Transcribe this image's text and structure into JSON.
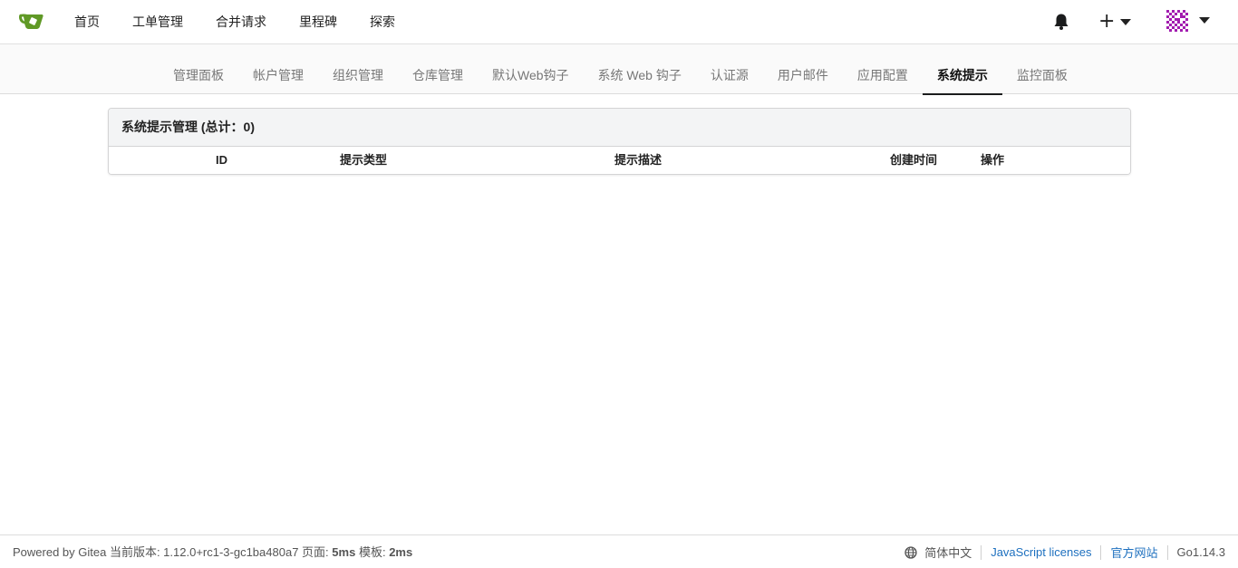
{
  "navbar": {
    "links": [
      "首页",
      "工单管理",
      "合并请求",
      "里程碑",
      "探索"
    ],
    "icons": [
      "gitea-logo-icon",
      "bell-icon",
      "plus-icon",
      "caret-down-icon",
      "avatar"
    ],
    "brand_color": "#609926"
  },
  "admin_menu": {
    "items": [
      "管理面板",
      "帐户管理",
      "组织管理",
      "仓库管理",
      "默认Web钩子",
      "系统 Web 钩子",
      "认证源",
      "用户邮件",
      "应用配置",
      "系统提示",
      "监控面板"
    ],
    "active_index": 9
  },
  "notices": {
    "header": "系统提示管理 (总计：0)",
    "columns": [
      "ID",
      "提示类型",
      "提示描述",
      "创建时间",
      "操作"
    ],
    "rows": []
  },
  "footer": {
    "powered_by": "Powered by Gitea 当前版本: 1.12.0+rc1-3-gc1ba480a7 页面:",
    "page_time": "5ms",
    "template_label": "模板:",
    "template_time": "2ms",
    "language": "简体中文",
    "js_licenses": "JavaScript licenses",
    "website": "官方网站",
    "go_version": "Go1.14.3",
    "link_color": "#1e70bf"
  }
}
